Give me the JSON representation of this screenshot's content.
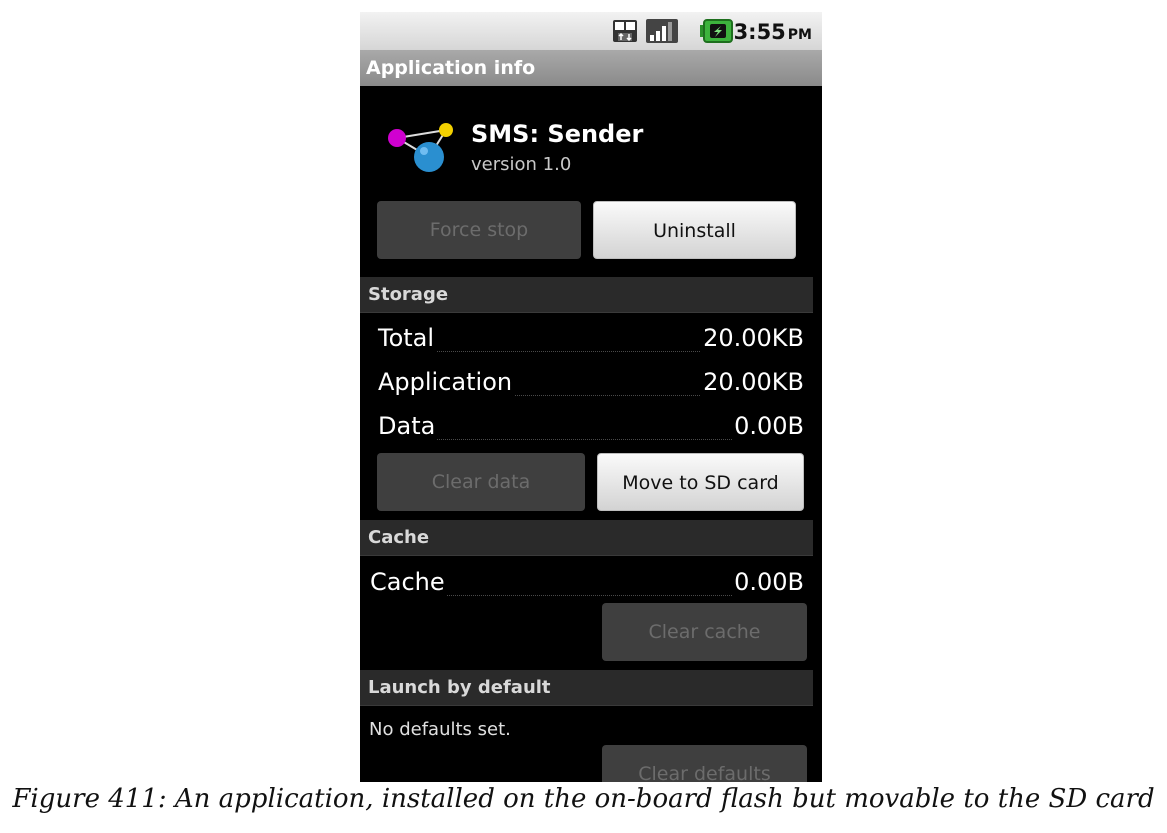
{
  "status_bar": {
    "time": "3:55",
    "ampm": "PM",
    "icons": [
      "network-3g-icon",
      "signal-bars-icon",
      "battery-charging-icon"
    ]
  },
  "title_bar": "Application info",
  "app": {
    "name": "SMS: Sender",
    "version": "version 1.0",
    "icon": "molecule-app-icon"
  },
  "top_buttons": {
    "force_stop": "Force stop",
    "uninstall": "Uninstall"
  },
  "storage": {
    "header": "Storage",
    "rows": [
      {
        "label": "Total",
        "value": "20.00KB"
      },
      {
        "label": "Application",
        "value": "20.00KB"
      },
      {
        "label": "Data",
        "value": "0.00B"
      }
    ],
    "clear_data": "Clear data",
    "move_to_sd": "Move to SD card"
  },
  "cache": {
    "header": "Cache",
    "label": "Cache",
    "value": "0.00B",
    "clear_cache": "Clear cache"
  },
  "launch": {
    "header": "Launch by default",
    "text": "No defaults set.",
    "clear_defaults": "Clear defaults"
  },
  "caption": "Figure 411: An application, installed on the on-board flash but movable to the SD card",
  "colors": {
    "background": "#000000",
    "section_header": "#2a2a2a",
    "disabled_button": "#3f3f3f",
    "enabled_button": "#e6e6e6"
  }
}
